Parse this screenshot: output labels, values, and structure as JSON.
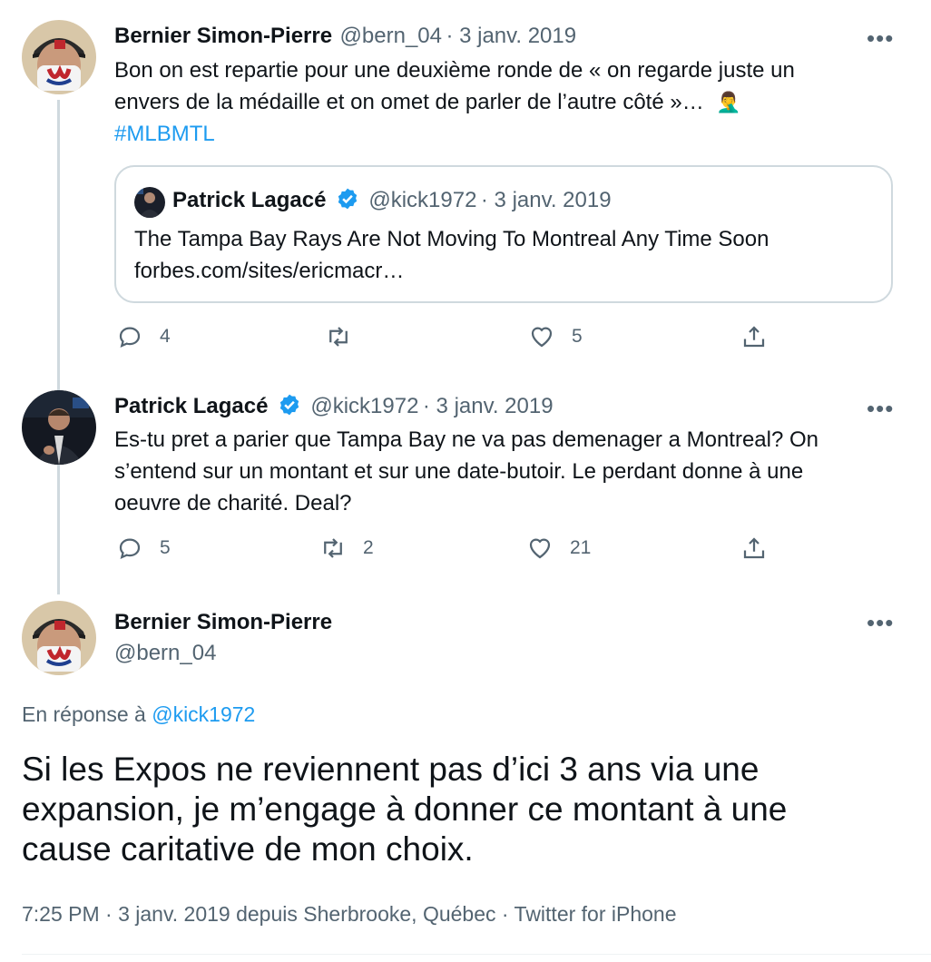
{
  "tweet1": {
    "name": "Bernier Simon-Pierre",
    "handle": "@bern_04",
    "date": "· 3 janv. 2019",
    "text_line1": "Bon on est repartie pour une deuxième ronde de « on regarde juste un",
    "text_line2": "envers de la médaille et on omet de parler de l’autre côté »…",
    "emoji": "🤦‍♂️",
    "hashtag": "#MLBMTL",
    "quote": {
      "name": "Patrick Lagacé",
      "handle": "@kick1972",
      "date": "· 3 janv. 2019",
      "title": "The Tampa Bay Rays Are Not Moving To Montreal Any Time Soon",
      "link": "forbes.com/sites/ericmacr…"
    },
    "replies": "4",
    "retweets": "",
    "likes": "5"
  },
  "tweet2": {
    "name": "Patrick Lagacé",
    "handle": "@kick1972",
    "date": "· 3 janv. 2019",
    "text_line1": "Es-tu pret a parier que Tampa Bay ne va pas demenager a Montreal? On",
    "text_line2": "s’entend sur un montant et sur une date-butoir. Le perdant donne à une",
    "text_line3": "oeuvre de charité. Deal?",
    "replies": "5",
    "retweets": "2",
    "likes": "21"
  },
  "main": {
    "name": "Bernier Simon-Pierre",
    "handle": "@bern_04",
    "reply_prefix": "En réponse à",
    "reply_to": "@kick1972",
    "text_line1": "Si les Expos ne reviennent pas d’ici 3 ans via une",
    "text_line2": "expansion, je m’engage à donner ce montant à une",
    "text_line3": "cause caritative de mon choix.",
    "meta": "7:25 PM · 3 janv. 2019 depuis Sherbrooke, Québec · Twitter for iPhone"
  },
  "more_label": "•••",
  "colors": {
    "accent": "#1d9bf0",
    "muted": "#536471",
    "line": "#cfd9de"
  }
}
